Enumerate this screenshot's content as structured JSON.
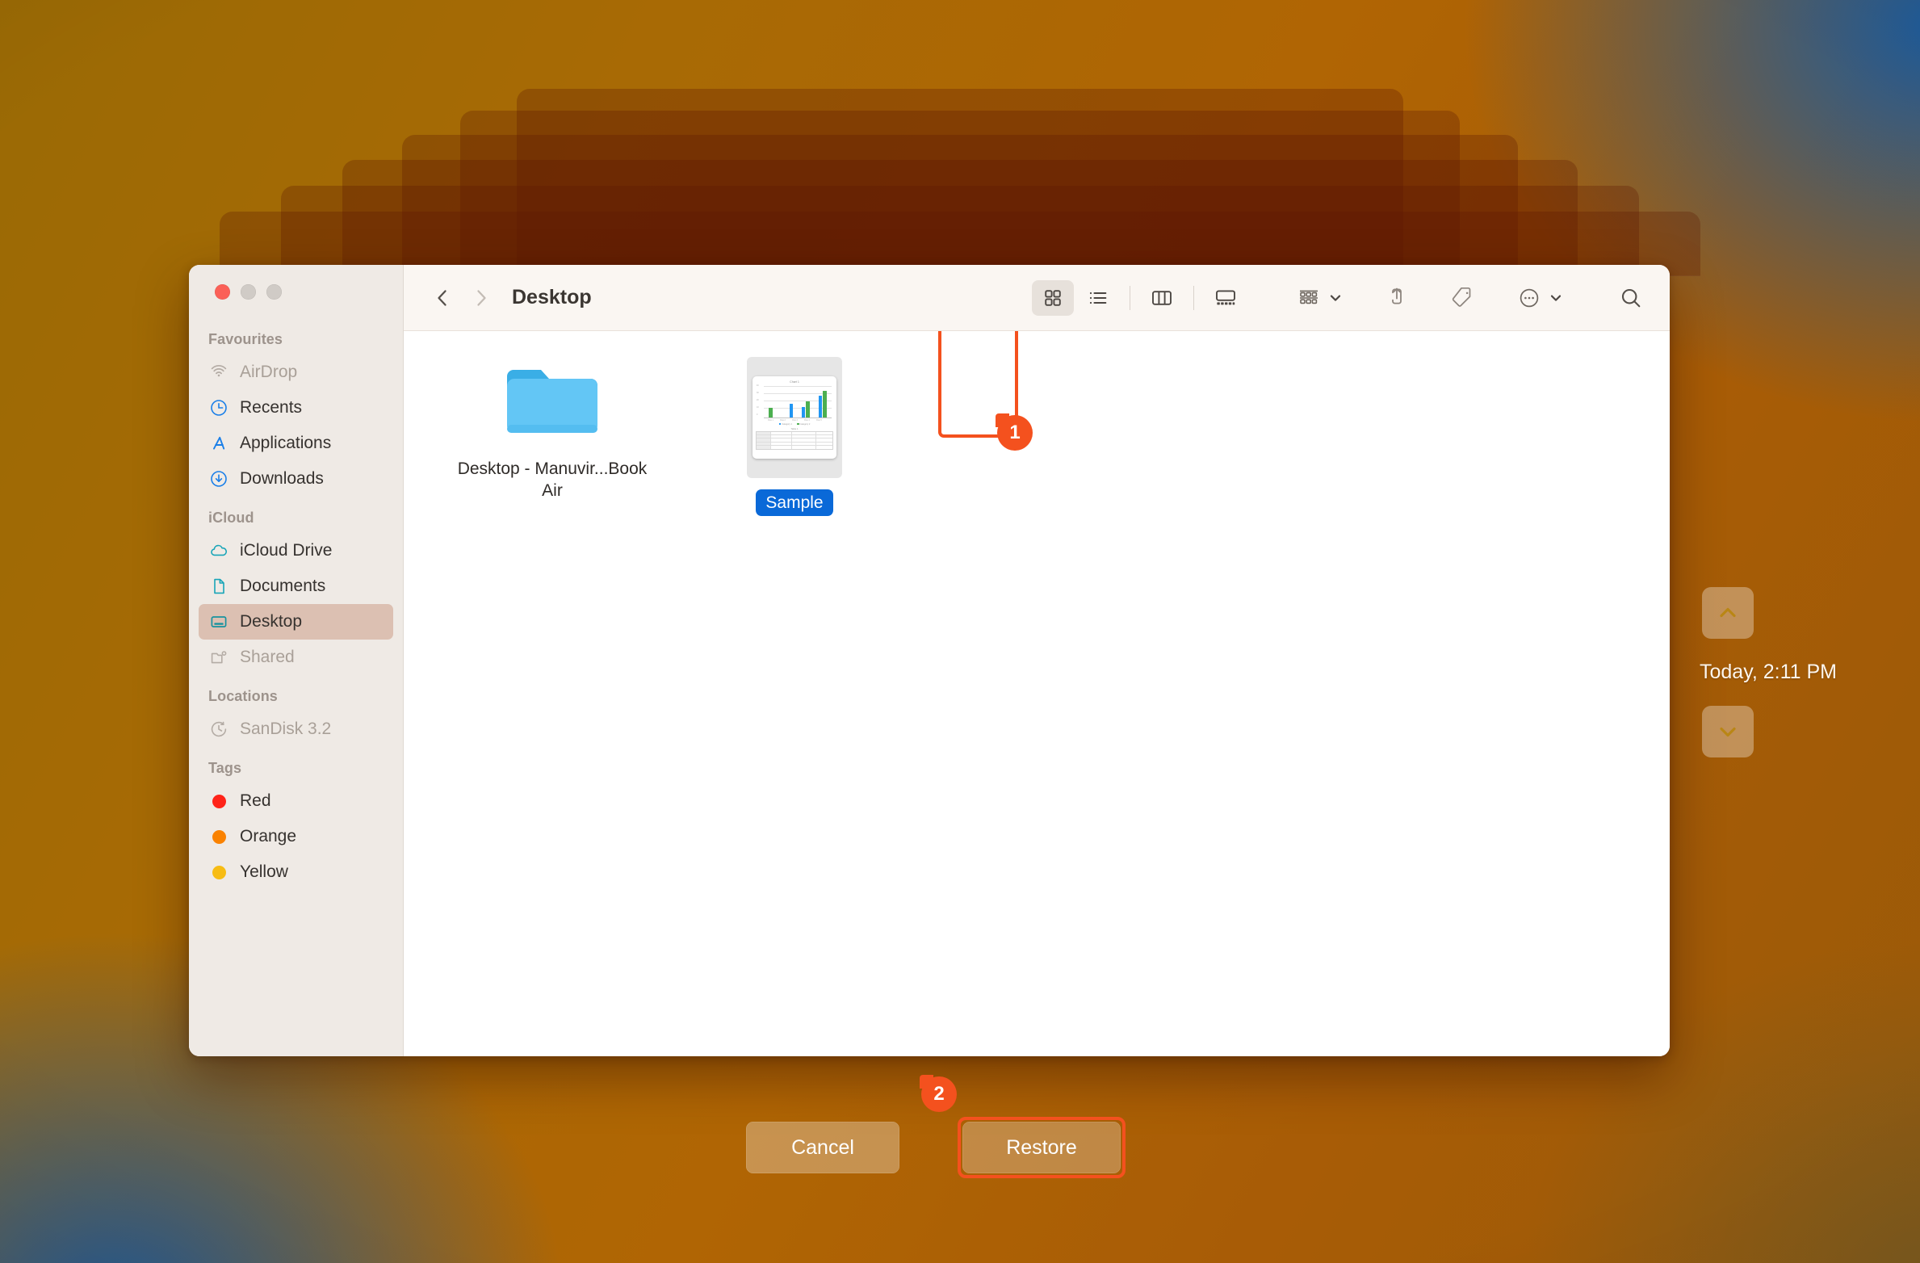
{
  "window": {
    "title": "Desktop",
    "traffic_lights": [
      "close",
      "minimize",
      "zoom"
    ],
    "back_label": "Back",
    "forward_label": "Forward"
  },
  "sidebar": {
    "groups": [
      {
        "heading": "Favourites",
        "items": [
          {
            "label": "AirDrop",
            "icon": "airdrop-icon",
            "state": "dim"
          },
          {
            "label": "Recents",
            "icon": "clock-icon",
            "state": "normal"
          },
          {
            "label": "Applications",
            "icon": "applications-icon",
            "state": "normal"
          },
          {
            "label": "Downloads",
            "icon": "download-icon",
            "state": "normal"
          }
        ]
      },
      {
        "heading": "iCloud",
        "items": [
          {
            "label": "iCloud Drive",
            "icon": "cloud-icon",
            "state": "normal"
          },
          {
            "label": "Documents",
            "icon": "document-icon",
            "state": "normal"
          },
          {
            "label": "Desktop",
            "icon": "desktop-icon",
            "state": "selected"
          },
          {
            "label": "Shared",
            "icon": "shared-folder-icon",
            "state": "dim"
          }
        ]
      },
      {
        "heading": "Locations",
        "items": [
          {
            "label": "SanDisk 3.2",
            "icon": "time-machine-disk-icon",
            "state": "dim"
          }
        ]
      },
      {
        "heading": "Tags",
        "items": [
          {
            "label": "Red",
            "icon": "tag-dot-red",
            "color": "#ff2419"
          },
          {
            "label": "Orange",
            "icon": "tag-dot-orange",
            "color": "#fa8200"
          },
          {
            "label": "Yellow",
            "icon": "tag-dot-yellow",
            "color": "#f7bc13"
          }
        ]
      }
    ]
  },
  "toolbar": {
    "view_modes": [
      {
        "name": "icon-view",
        "label": "Icon View",
        "active": true
      },
      {
        "name": "list-view",
        "label": "List View",
        "active": false
      },
      {
        "name": "column-view",
        "label": "Column View",
        "active": false
      },
      {
        "name": "gallery-view",
        "label": "Gallery View",
        "active": false
      }
    ],
    "group_label": "Group",
    "share_label": "Share",
    "tags_label": "Tags",
    "more_label": "More",
    "search_label": "Search"
  },
  "content": {
    "files": [
      {
        "name": "Desktop - Manuvir...Book Air",
        "kind": "folder",
        "selected": false
      },
      {
        "name": "Sample",
        "kind": "document",
        "selected": true
      }
    ]
  },
  "thumbnail_chart": {
    "title": "Chart 1",
    "table_title": "Table 1",
    "y_ticks": [
      "40",
      "30",
      "20",
      "10",
      "0"
    ],
    "x_ticks": [
      "Row 1",
      "Row 2",
      "Row 3",
      "Row 4",
      "Row 5"
    ],
    "legend": [
      "Category 1",
      "Category 2"
    ],
    "colors": {
      "category_1": "#2196f3",
      "category_2": "#4caf50"
    }
  },
  "chart_data": {
    "type": "bar",
    "title": "Chart 1",
    "xlabel": "",
    "ylabel": "",
    "ylim": [
      0,
      40
    ],
    "grid": true,
    "legend_position": "bottom",
    "categories": [
      "Row 1",
      "Row 2",
      "Row 3",
      "Row 4",
      "Row 5"
    ],
    "series": [
      {
        "name": "Category 1",
        "color": "#2196f3",
        "values": [
          0,
          0,
          17,
          13,
          27
        ]
      },
      {
        "name": "Category 2",
        "color": "#4caf50",
        "values": [
          12,
          0,
          0,
          20,
          33
        ]
      }
    ]
  },
  "annotations": [
    {
      "id": "1",
      "target": "sample-file",
      "label": "1"
    },
    {
      "id": "2",
      "target": "restore-button",
      "label": "2"
    }
  ],
  "footer": {
    "cancel_label": "Cancel",
    "restore_label": "Restore"
  },
  "time_machine": {
    "up_label": "Go Back In Time",
    "down_label": "Go Forward In Time",
    "current_snapshot": "Today, 2:11 PM"
  },
  "colors": {
    "accent_highlight": "#f4511e",
    "selection_blue": "#0a69d8",
    "sidebar_selection": "#dcc0b2"
  }
}
